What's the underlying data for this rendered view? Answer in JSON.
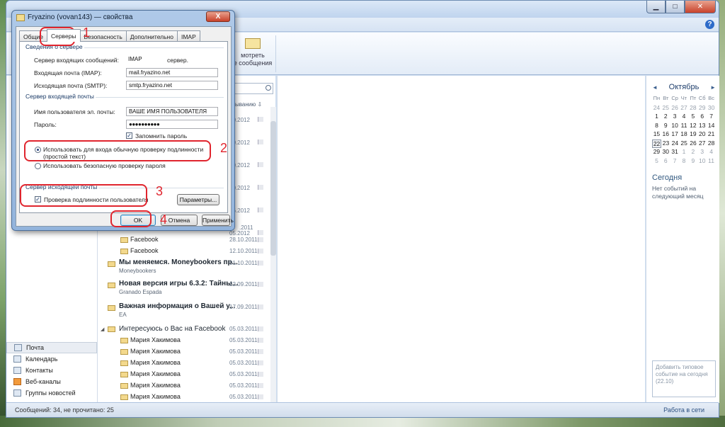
{
  "main_window": {
    "ribbon": {
      "view_label_line1": "мотреть",
      "view_label_line2": "е сообщения"
    },
    "message_list": {
      "sort_label": "ыванию",
      "rows_top": [
        {
          "date": "10.2012"
        },
        {
          "date": "10.2012"
        },
        {
          "date": "10.2012"
        },
        {
          "date": "10.2012"
        },
        {
          "date": "06.2012"
        },
        {
          "date": "05.2012"
        },
        {
          "date": ".2011"
        }
      ],
      "rows": [
        {
          "from": "Facebook",
          "date": "28.10.2011",
          "kind": "child"
        },
        {
          "from": "Facebook",
          "date": "12.10.2011",
          "kind": "child"
        },
        {
          "subject": "Мы меняемся. Moneybookers пр...",
          "from": "Moneybookers",
          "date": "01.10.2011",
          "kind": "thread"
        },
        {
          "subject": "Новая версия игры 6.3.2: Тайны...",
          "from": "Granado Espada",
          "date": "22.09.2011",
          "kind": "thread"
        },
        {
          "subject": "Важная информация о Вашей у...",
          "from": "EA",
          "date": "17.09.2011",
          "kind": "thread"
        },
        {
          "subject": "Интересуюсь о Вас на Facebook",
          "date": "05.03.2011",
          "kind": "group"
        },
        {
          "from": "Мария Хакимова",
          "date": "05.03.2011",
          "kind": "child"
        },
        {
          "from": "Мария Хакимова",
          "date": "05.03.2011",
          "kind": "child"
        },
        {
          "from": "Мария Хакимова",
          "date": "05.03.2011",
          "kind": "child"
        },
        {
          "from": "Мария Хакимова",
          "date": "05.03.2011",
          "kind": "child"
        },
        {
          "from": "Мария Хакимова",
          "date": "05.03.2011",
          "kind": "child"
        },
        {
          "from": "Мария Хакимова",
          "date": "05.03.2011",
          "kind": "child"
        }
      ]
    },
    "nav": [
      {
        "label": "Почта",
        "icon": "mail-icon",
        "active": true
      },
      {
        "label": "Календарь",
        "icon": "calendar-icon"
      },
      {
        "label": "Контакты",
        "icon": "contacts-icon"
      },
      {
        "label": "Веб-каналы",
        "icon": "rss-icon"
      },
      {
        "label": "Группы новостей",
        "icon": "newsgroups-icon"
      }
    ],
    "calendar": {
      "prev": "◄",
      "month": "Октябрь",
      "next": "►",
      "day_names": [
        "Пн",
        "Вт",
        "Ср",
        "Чт",
        "Пт",
        "Сб",
        "Вс"
      ],
      "weeks": [
        [
          "24",
          "25",
          "26",
          "27",
          "28",
          "29",
          "30"
        ],
        [
          "1",
          "2",
          "3",
          "4",
          "5",
          "6",
          "7"
        ],
        [
          "8",
          "9",
          "10",
          "11",
          "12",
          "13",
          "14"
        ],
        [
          "15",
          "16",
          "17",
          "18",
          "19",
          "20",
          "21"
        ],
        [
          "22",
          "23",
          "24",
          "25",
          "26",
          "27",
          "28"
        ],
        [
          "29",
          "30",
          "31",
          "1",
          "2",
          "3",
          "4"
        ],
        [
          "5",
          "6",
          "7",
          "8",
          "9",
          "10",
          "11"
        ]
      ],
      "today_day": "22",
      "today_title": "Сегодня",
      "today_text": "Нет событий на следующий месяц",
      "add_event": "Добавить типовое событие на сегодня (22.10)"
    },
    "status": {
      "left": "Сообщений: 34, не прочитано: 25",
      "right": "Работа в сети"
    }
  },
  "dialog": {
    "title": "Fryazino (vovan143) — свойства",
    "close": "X",
    "tabs": [
      "Общие",
      "Серверы",
      "Безопасность",
      "Дополнительно",
      "IMAP"
    ],
    "active_tab": "Серверы",
    "server_info": {
      "group_label": "Сведения о сервере",
      "incoming_type_label": "Сервер входящих сообщений:",
      "incoming_type_value": "IMAP",
      "incoming_type_suffix": "сервер.",
      "incoming_label": "Входящая почта (IMAP):",
      "incoming_value": "mail.fryazino.net",
      "outgoing_label": "Исходящая почта (SMTP):",
      "outgoing_value": "smtp.fryazino.net"
    },
    "incoming_server": {
      "group_label": "Сервер входящей почты",
      "username_label": "Имя пользователя эл. почты:",
      "username_value": "ВАШЕ ИМЯ ПОЛЬЗОВАТЕЛЯ",
      "password_label": "Пароль:",
      "password_value": "●●●●●●●●●●",
      "remember_password": "Запомнить пароль",
      "auth_plain": "Использовать для входа обычную проверку подлинности (простой текст)",
      "auth_secure": "Использовать безопасную проверку пароля"
    },
    "outgoing_server": {
      "group_label": "Сервер исходящей почты",
      "requires_auth": "Проверка подлинности пользователя",
      "settings_button": "Параметры..."
    },
    "buttons": {
      "ok": "OK",
      "cancel": "Отмена",
      "apply": "Применить"
    }
  },
  "annotations": [
    "1",
    "2",
    "3",
    "4"
  ],
  "colors": {
    "annotation": "#e0252e",
    "accent": "#2d6bc9"
  }
}
